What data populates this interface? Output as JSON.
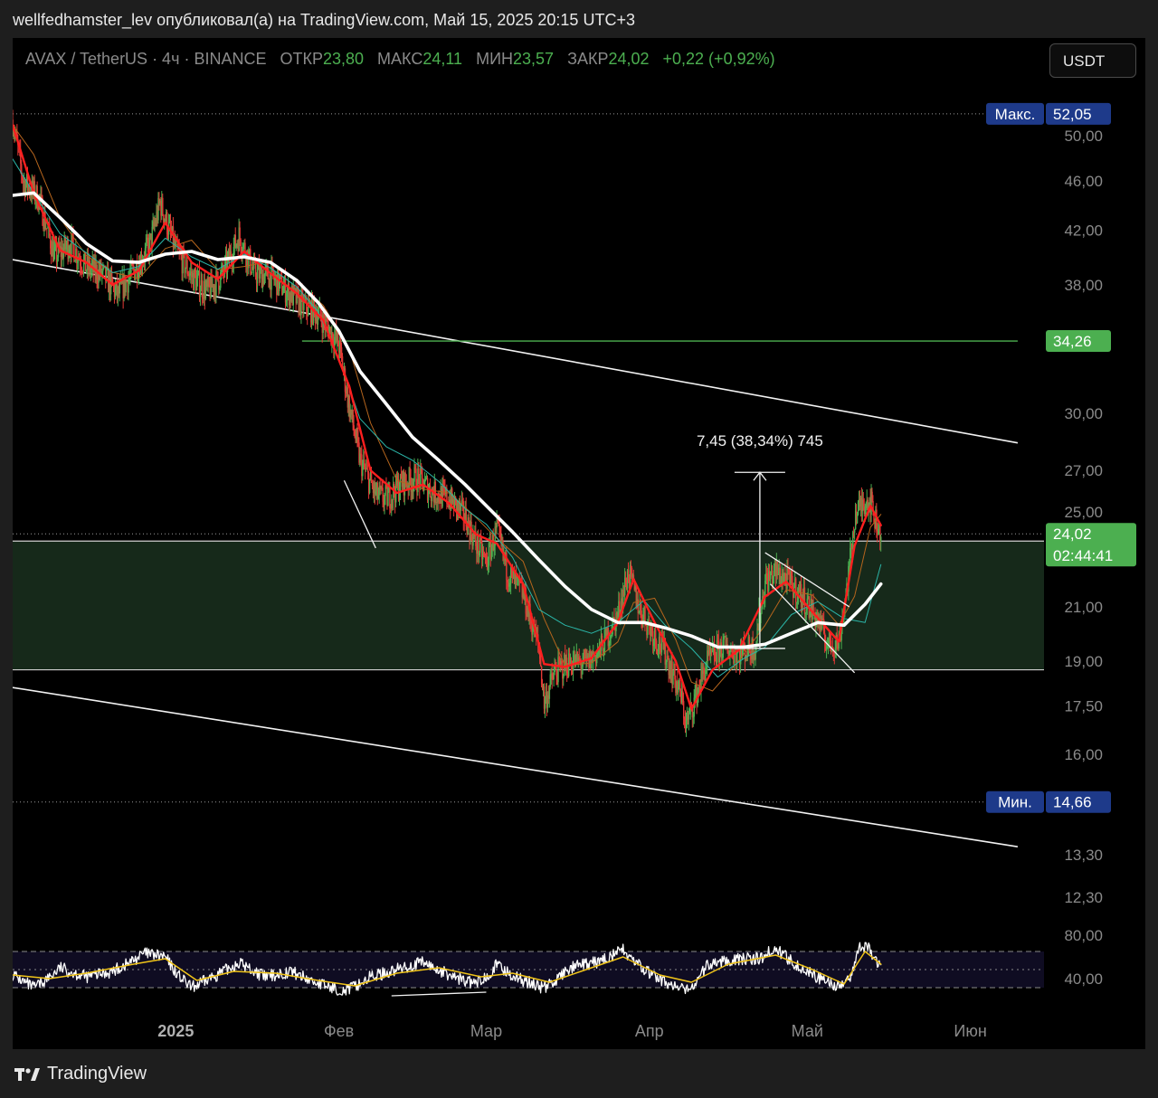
{
  "caption": "wellfedhamster_lev опубликовал(а) на TradingView.com, Май 15, 2025 20:15 UTC+3",
  "legend": {
    "symbol": "AVAX / TetherUS · 4ч · BINANCE",
    "open_label": "ОТКР",
    "open": "23,80",
    "high_label": "МАКС",
    "high": "24,11",
    "low_label": "МИН",
    "low": "23,57",
    "close_label": "ЗАКР",
    "close": "24,02",
    "change": "+0,22 (+0,92%)"
  },
  "currency_button": "USDT",
  "brand": "TradingView",
  "colors": {
    "up": "#4caf50",
    "down": "#e53935",
    "ema_fast": "#ff1f1f",
    "ema_slow": "#ffffff",
    "zone": "#16291a",
    "rsi": "#ffffff",
    "rsi_ma": "#f0c419",
    "label_blue": "#1e3a8a",
    "label_green": "#4caf50"
  },
  "chart_data": {
    "type": "candlestick",
    "symbol": "AVAX / TetherUS",
    "interval": "4ч",
    "exchange": "BINANCE",
    "scale": "log",
    "ylim": [
      11.8,
      56
    ],
    "y_ticks": [
      "50,00",
      "46,00",
      "42,00",
      "38,00",
      "30,00",
      "27,00",
      "25,00",
      "21,00",
      "19,00",
      "17,50",
      "16,00",
      "13,30",
      "12,30"
    ],
    "x_ticks": [
      "2025",
      "Фев",
      "Мар",
      "Апр",
      "Май",
      "Июн"
    ],
    "x_tick_dates": [
      "2025-01-01",
      "2025-02-01",
      "2025-03-01",
      "2025-04-01",
      "2025-05-01",
      "2025-06-01"
    ],
    "xlim": [
      "2024-12-01",
      "2025-06-15"
    ],
    "price_path": [
      [
        "2024-12-01",
        51.5
      ],
      [
        "2024-12-03",
        46
      ],
      [
        "2024-12-06",
        44.5
      ],
      [
        "2024-12-09",
        40
      ],
      [
        "2024-12-12",
        41
      ],
      [
        "2024-12-15",
        39.2
      ],
      [
        "2024-12-18",
        38.8
      ],
      [
        "2024-12-21",
        37.3
      ],
      [
        "2024-12-24",
        39
      ],
      [
        "2024-12-27",
        40.8
      ],
      [
        "2024-12-29",
        44.2
      ],
      [
        "2025-01-01",
        40.5
      ],
      [
        "2025-01-04",
        38.6
      ],
      [
        "2025-01-07",
        37.5
      ],
      [
        "2025-01-10",
        38.8
      ],
      [
        "2025-01-13",
        41.6
      ],
      [
        "2025-01-16",
        38.8
      ],
      [
        "2025-01-19",
        38.6
      ],
      [
        "2025-01-22",
        37.6
      ],
      [
        "2025-01-25",
        36.6
      ],
      [
        "2025-01-28",
        36.1
      ],
      [
        "2025-02-01",
        34
      ],
      [
        "2025-02-03",
        30.3
      ],
      [
        "2025-02-05",
        27.5
      ],
      [
        "2025-02-08",
        25.8
      ],
      [
        "2025-02-10",
        25.6
      ],
      [
        "2025-02-13",
        26.4
      ],
      [
        "2025-02-16",
        26.6
      ],
      [
        "2025-02-19",
        25.9
      ],
      [
        "2025-02-22",
        25.6
      ],
      [
        "2025-02-25",
        24.8
      ],
      [
        "2025-02-27",
        23.6
      ],
      [
        "2025-03-01",
        22.8
      ],
      [
        "2025-03-03",
        24.2
      ],
      [
        "2025-03-05",
        22.4
      ],
      [
        "2025-03-08",
        21.5
      ],
      [
        "2025-03-11",
        19.5
      ],
      [
        "2025-03-12",
        17.6
      ],
      [
        "2025-03-14",
        18.6
      ],
      [
        "2025-03-17",
        19
      ],
      [
        "2025-03-20",
        18.9
      ],
      [
        "2025-03-23",
        19.5
      ],
      [
        "2025-03-26",
        20.7
      ],
      [
        "2025-03-28",
        22.4
      ],
      [
        "2025-03-30",
        21
      ],
      [
        "2025-04-02",
        19.9
      ],
      [
        "2025-04-04",
        19.3
      ],
      [
        "2025-04-07",
        17.8
      ],
      [
        "2025-04-08",
        16.9
      ],
      [
        "2025-04-10",
        17.9
      ],
      [
        "2025-04-12",
        19
      ],
      [
        "2025-04-15",
        19.5
      ],
      [
        "2025-04-18",
        19.3
      ],
      [
        "2025-04-21",
        19.5
      ],
      [
        "2025-04-23",
        22
      ],
      [
        "2025-04-25",
        22.4
      ],
      [
        "2025-04-27",
        22.1
      ],
      [
        "2025-04-30",
        21.4
      ],
      [
        "2025-05-03",
        20.5
      ],
      [
        "2025-05-05",
        19.6
      ],
      [
        "2025-05-07",
        19.7
      ],
      [
        "2025-05-09",
        22.5
      ],
      [
        "2025-05-10",
        24.8
      ],
      [
        "2025-05-12",
        25.6
      ],
      [
        "2025-05-13",
        25.5
      ],
      [
        "2025-05-14",
        24.6
      ],
      [
        "2025-05-15",
        24.02
      ]
    ],
    "ema_fast_path": [
      [
        "2024-12-01",
        51
      ],
      [
        "2024-12-05",
        45
      ],
      [
        "2024-12-10",
        40.5
      ],
      [
        "2024-12-15",
        39.6
      ],
      [
        "2024-12-20",
        38
      ],
      [
        "2024-12-25",
        39
      ],
      [
        "2024-12-30",
        42.6
      ],
      [
        "2025-01-04",
        39.6
      ],
      [
        "2025-01-09",
        38.4
      ],
      [
        "2025-01-14",
        40.4
      ],
      [
        "2025-01-19",
        38.8
      ],
      [
        "2025-01-24",
        37.4
      ],
      [
        "2025-01-29",
        35.6
      ],
      [
        "2025-02-03",
        31.5
      ],
      [
        "2025-02-07",
        27
      ],
      [
        "2025-02-12",
        25.9
      ],
      [
        "2025-02-17",
        26.3
      ],
      [
        "2025-02-22",
        25.4
      ],
      [
        "2025-02-27",
        24
      ],
      [
        "2025-03-03",
        23.6
      ],
      [
        "2025-03-08",
        21.9
      ],
      [
        "2025-03-12",
        18.9
      ],
      [
        "2025-03-16",
        18.8
      ],
      [
        "2025-03-21",
        19.1
      ],
      [
        "2025-03-26",
        20.4
      ],
      [
        "2025-03-29",
        22.1
      ],
      [
        "2025-04-02",
        20.4
      ],
      [
        "2025-04-06",
        19
      ],
      [
        "2025-04-09",
        17.4
      ],
      [
        "2025-04-13",
        18.7
      ],
      [
        "2025-04-18",
        19.4
      ],
      [
        "2025-04-23",
        21.4
      ],
      [
        "2025-04-27",
        22
      ],
      [
        "2025-05-02",
        20.8
      ],
      [
        "2025-05-07",
        19.7
      ],
      [
        "2025-05-10",
        23.5
      ],
      [
        "2025-05-13",
        25.3
      ],
      [
        "2025-05-15",
        24.4
      ]
    ],
    "ema_slow_path": [
      [
        "2024-12-01",
        44.8
      ],
      [
        "2024-12-05",
        45
      ],
      [
        "2024-12-10",
        43
      ],
      [
        "2024-12-15",
        41
      ],
      [
        "2024-12-20",
        39.7
      ],
      [
        "2024-12-25",
        39.6
      ],
      [
        "2024-12-30",
        40.2
      ],
      [
        "2025-01-04",
        40.4
      ],
      [
        "2025-01-09",
        39.8
      ],
      [
        "2025-01-14",
        40
      ],
      [
        "2025-01-19",
        39.6
      ],
      [
        "2025-01-24",
        38.3
      ],
      [
        "2025-01-28",
        36.8
      ],
      [
        "2025-02-01",
        34.9
      ],
      [
        "2025-02-05",
        32.4
      ],
      [
        "2025-02-10",
        30.5
      ],
      [
        "2025-02-15",
        28.7
      ],
      [
        "2025-02-20",
        27.5
      ],
      [
        "2025-02-25",
        26.3
      ],
      [
        "2025-03-01",
        25.3
      ],
      [
        "2025-03-06",
        24.1
      ],
      [
        "2025-03-11",
        22.9
      ],
      [
        "2025-03-16",
        21.8
      ],
      [
        "2025-03-21",
        20.9
      ],
      [
        "2025-03-26",
        20.4
      ],
      [
        "2025-03-31",
        20.4
      ],
      [
        "2025-04-04",
        20.2
      ],
      [
        "2025-04-09",
        19.9
      ],
      [
        "2025-04-14",
        19.5
      ],
      [
        "2025-04-19",
        19.5
      ],
      [
        "2025-04-23",
        19.6
      ],
      [
        "2025-04-28",
        20
      ],
      [
        "2025-05-03",
        20.4
      ],
      [
        "2025-05-08",
        20.3
      ],
      [
        "2025-05-12",
        21.1
      ],
      [
        "2025-05-15",
        21.9
      ]
    ],
    "zone": {
      "low": 18.7,
      "high": 23.7
    },
    "channel_upper": {
      "from": [
        "2024-12-01",
        39.8
      ],
      "to": [
        "2025-06-10",
        28.4
      ]
    },
    "channel_lower": {
      "from": [
        "2024-12-01",
        18.1
      ],
      "to": [
        "2025-06-10",
        13.5
      ]
    },
    "resistance_line": {
      "price": 34.26,
      "from": "2025-01-25",
      "to": "2025-06-10"
    },
    "flag_lines": [
      {
        "from": [
          "2025-02-02",
          26.5
        ],
        "to": [
          "2025-02-08",
          23.4
        ]
      },
      {
        "from": [
          "2025-04-23",
          23.2
        ],
        "to": [
          "2025-05-09",
          21
        ]
      },
      {
        "from": [
          "2025-04-24",
          21.9
        ],
        "to": [
          "2025-05-10",
          18.6
        ]
      }
    ],
    "measure": {
      "date": "2025-04-22",
      "from_price": 19.45,
      "to_price": 26.9,
      "label": "7,45 (38,34%) 745"
    },
    "price_labels": [
      {
        "label": "Макс.",
        "value": "52,05",
        "price": 52.05,
        "style": "blue"
      },
      {
        "label": "",
        "value": "34,26",
        "price": 34.26,
        "style": "green"
      },
      {
        "label": "",
        "value": "24,02",
        "sub": "02:44:41",
        "price": 24.02,
        "style": "green"
      },
      {
        "label": "Мин.",
        "value": "14,66",
        "price": 14.66,
        "style": "blue"
      }
    ],
    "rsi": {
      "y_ticks": [
        "80,00",
        "40,00"
      ],
      "upper": 70,
      "mid": 50,
      "lower": 30,
      "path": [
        [
          "2024-12-01",
          45
        ],
        [
          "2024-12-05",
          30
        ],
        [
          "2024-12-10",
          52
        ],
        [
          "2024-12-15",
          42
        ],
        [
          "2024-12-20",
          48
        ],
        [
          "2024-12-26",
          68
        ],
        [
          "2024-12-30",
          64
        ],
        [
          "2025-01-04",
          30
        ],
        [
          "2025-01-08",
          42
        ],
        [
          "2025-01-13",
          58
        ],
        [
          "2025-01-18",
          42
        ],
        [
          "2025-01-23",
          48
        ],
        [
          "2025-01-28",
          35
        ],
        [
          "2025-02-02",
          26
        ],
        [
          "2025-02-07",
          42
        ],
        [
          "2025-02-12",
          50
        ],
        [
          "2025-02-17",
          58
        ],
        [
          "2025-02-22",
          44
        ],
        [
          "2025-02-27",
          34
        ],
        [
          "2025-03-03",
          55
        ],
        [
          "2025-03-08",
          38
        ],
        [
          "2025-03-12",
          30
        ],
        [
          "2025-03-17",
          52
        ],
        [
          "2025-03-22",
          58
        ],
        [
          "2025-03-27",
          72
        ],
        [
          "2025-03-31",
          50
        ],
        [
          "2025-04-04",
          36
        ],
        [
          "2025-04-08",
          26
        ],
        [
          "2025-04-12",
          55
        ],
        [
          "2025-04-17",
          62
        ],
        [
          "2025-04-22",
          62
        ],
        [
          "2025-04-25",
          74
        ],
        [
          "2025-04-30",
          52
        ],
        [
          "2025-05-05",
          36
        ],
        [
          "2025-05-08",
          30
        ],
        [
          "2025-05-11",
          78
        ],
        [
          "2025-05-13",
          72
        ],
        [
          "2025-05-15",
          50
        ]
      ],
      "ma_path": [
        [
          "2024-12-01",
          44
        ],
        [
          "2024-12-08",
          40
        ],
        [
          "2024-12-15",
          46
        ],
        [
          "2024-12-24",
          56
        ],
        [
          "2024-12-30",
          62
        ],
        [
          "2025-01-05",
          38
        ],
        [
          "2025-01-12",
          48
        ],
        [
          "2025-01-20",
          46
        ],
        [
          "2025-01-28",
          38
        ],
        [
          "2025-02-04",
          32
        ],
        [
          "2025-02-12",
          46
        ],
        [
          "2025-02-20",
          52
        ],
        [
          "2025-02-28",
          42
        ],
        [
          "2025-03-06",
          46
        ],
        [
          "2025-03-13",
          36
        ],
        [
          "2025-03-20",
          50
        ],
        [
          "2025-03-27",
          64
        ],
        [
          "2025-04-03",
          44
        ],
        [
          "2025-04-09",
          36
        ],
        [
          "2025-04-16",
          56
        ],
        [
          "2025-04-25",
          66
        ],
        [
          "2025-05-02",
          50
        ],
        [
          "2025-05-08",
          34
        ],
        [
          "2025-05-12",
          70
        ],
        [
          "2025-05-15",
          56
        ]
      ],
      "divergence_line": {
        "from": [
          "2025-02-11",
          27
        ],
        "to": [
          "2025-03-01",
          31
        ]
      }
    }
  }
}
